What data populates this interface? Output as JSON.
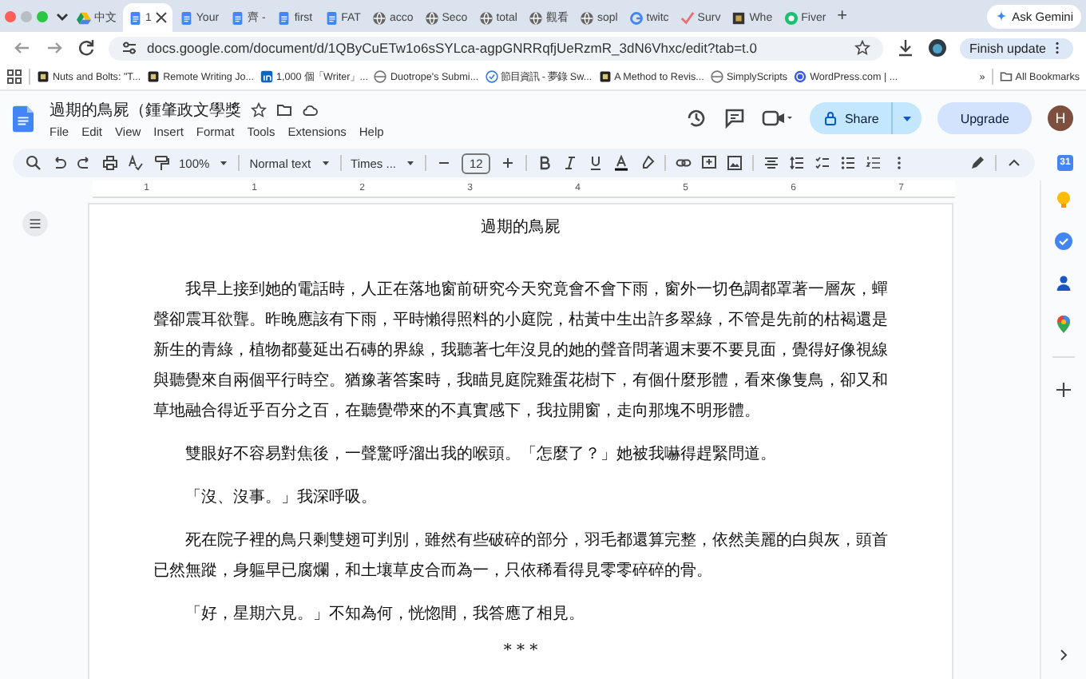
{
  "browser": {
    "tabs": [
      {
        "label": "中文",
        "kind": "drive",
        "selected": false
      },
      {
        "label": "1",
        "kind": "docs",
        "selected": true
      },
      {
        "label": "Your",
        "kind": "docs",
        "selected": false
      },
      {
        "label": "齊 -",
        "kind": "docs",
        "selected": false
      },
      {
        "label": "first",
        "kind": "docs",
        "selected": false
      },
      {
        "label": "FAT",
        "kind": "docs",
        "selected": false
      },
      {
        "label": "acco",
        "kind": "globe",
        "selected": false
      },
      {
        "label": "Seco",
        "kind": "globe",
        "selected": false
      },
      {
        "label": "total",
        "kind": "globe",
        "selected": false
      },
      {
        "label": "觀看",
        "kind": "globe",
        "selected": false
      },
      {
        "label": "sopl",
        "kind": "globe",
        "selected": false
      },
      {
        "label": "twitc",
        "kind": "google",
        "selected": false
      },
      {
        "label": "Surv",
        "kind": "check",
        "selected": false
      },
      {
        "label": "Whe",
        "kind": "square",
        "selected": false
      },
      {
        "label": "Fiver",
        "kind": "green",
        "selected": false
      }
    ],
    "new_tab": "+",
    "ask_gemini": "Ask Gemini",
    "url": "docs.google.com/document/d/1QByCuETw1o6sSYLca-agpGNRRqfjUeRzmR_3dN6Vhxc/edit?tab=t.0",
    "update_button": "Finish update",
    "bookmarks": [
      {
        "label": "Nuts and Bolts: \"T...",
        "kind": "square"
      },
      {
        "label": "Remote Writing Jo...",
        "kind": "square"
      },
      {
        "label": "1,000 個「Writer」...",
        "kind": "linkedin"
      },
      {
        "label": "Duotrope's Submi...",
        "kind": "globe"
      },
      {
        "label": "節目資訊 - 夢錄 Sw...",
        "kind": "check"
      },
      {
        "label": "A Method to Revis...",
        "kind": "square"
      },
      {
        "label": "SimplyScripts",
        "kind": "globe"
      },
      {
        "label": "WordPress.com | ...",
        "kind": "wp"
      }
    ],
    "more_bookmarks": "»",
    "all_bookmarks": "All Bookmarks"
  },
  "docs": {
    "title": "過期的鳥屍（鍾肇政文學獎",
    "menus": [
      "File",
      "Edit",
      "View",
      "Insert",
      "Format",
      "Tools",
      "Extensions",
      "Help"
    ],
    "share": "Share",
    "upgrade": "Upgrade",
    "avatar": "H",
    "toolbar": {
      "zoom": "100%",
      "style": "Normal text",
      "font": "Times ...",
      "size": "12"
    },
    "ruler": [
      "1",
      "1",
      "2",
      "3",
      "4",
      "5",
      "6",
      "7"
    ],
    "calendar_day": "31",
    "document": [
      {
        "kind": "title",
        "text": "過期的鳥屍"
      },
      {
        "kind": "body",
        "text": "我早上接到她的電話時，人正在落地窗前研究今天究竟會不會下雨，窗外一切色調都罩著一層灰，蟬聲卻震耳欲聾。昨晚應該有下雨，平時懶得照料的小庭院，枯黃中生出許多翠綠，不管是先前的枯褐還是新生的青綠，植物都蔓延出石磚的界線，我聽著七年沒見的她的聲音問著週末要不要見面，覺得好像視線與聽覺來自兩個平行時空。猶豫著答案時，我瞄見庭院雞蛋花樹下，有個什麼形體，看來像隻鳥，卻又和草地融合得近乎百分之百，在聽覺帶來的不真實感下，我拉開窗，走向那塊不明形體。"
      },
      {
        "kind": "body",
        "text": "雙眼好不容易對焦後，一聲驚呼溜出我的喉頭。「怎麼了？」她被我嚇得趕緊問道。"
      },
      {
        "kind": "body",
        "text": "「沒、沒事。」我深呼吸。"
      },
      {
        "kind": "body",
        "text": "死在院子裡的鳥只剩雙翅可判別，雖然有些破碎的部分，羽毛都還算完整，依然美麗的白與灰，頭首已然無蹤，身軀早已腐爛，和土壤草皮合而為一，只依稀看得見零零碎碎的骨。"
      },
      {
        "kind": "body",
        "text": "「好，星期六見。」不知為何，恍惚間，我答應了相見。"
      },
      {
        "kind": "separator",
        "text": "* * *"
      }
    ]
  }
}
